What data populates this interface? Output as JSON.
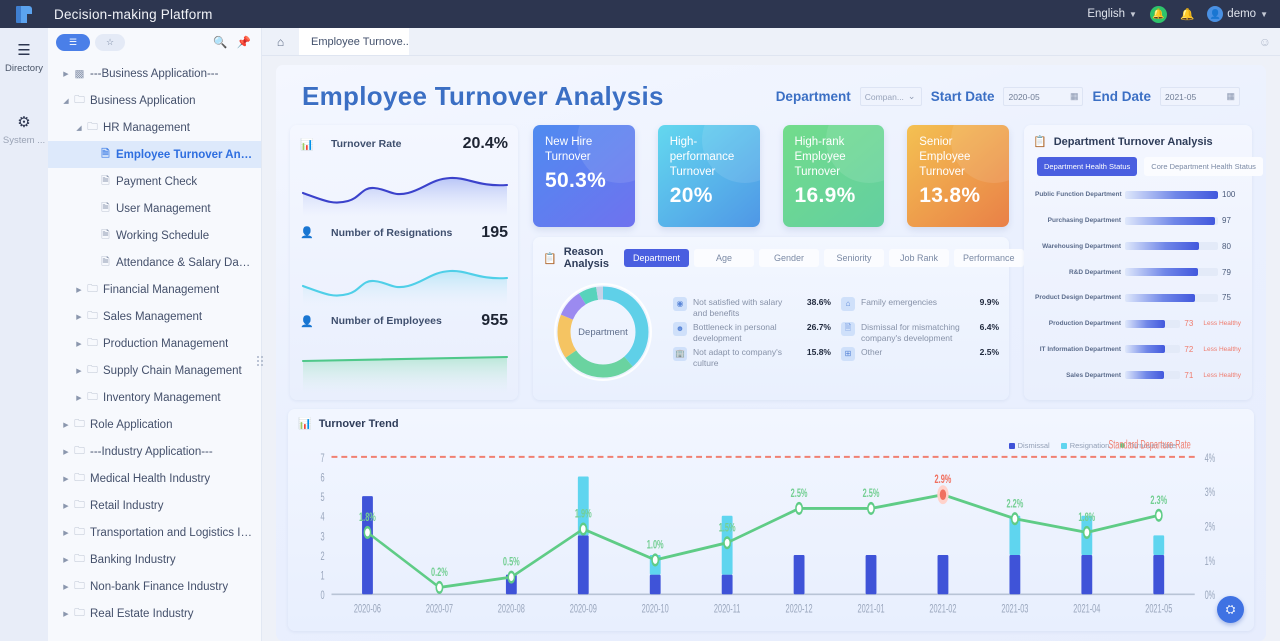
{
  "topbar": {
    "app_title": "Decision-making Platform",
    "language": "English",
    "user": "demo",
    "icons": {
      "logo": "app-logo",
      "notification_green": "green-bell-icon",
      "bell": "bell-icon",
      "avatar": "user-avatar"
    }
  },
  "rail": {
    "items": [
      {
        "label": "Directory",
        "icon": "list-icon"
      },
      {
        "label": "System ...",
        "icon": "gear-icon"
      }
    ]
  },
  "tree_toolbar": {
    "list_button": "list-view",
    "star_button": "favorites",
    "search": "search-icon",
    "pin": "pin-icon"
  },
  "tree": {
    "items": [
      {
        "label": "---Business Application---",
        "depth": 0,
        "arrow": "right",
        "icon": "apps-icon",
        "selected": false
      },
      {
        "label": "Business Application",
        "depth": 0,
        "arrow": "down",
        "icon": "folder-icon",
        "selected": false
      },
      {
        "label": "HR Management",
        "depth": 1,
        "arrow": "down",
        "icon": "folder-icon",
        "selected": false
      },
      {
        "label": "Employee Turnover Anal...",
        "depth": 2,
        "arrow": "none",
        "icon": "file-icon",
        "selected": true
      },
      {
        "label": "Payment Check",
        "depth": 2,
        "arrow": "none",
        "icon": "file-icon",
        "selected": false
      },
      {
        "label": "User Management",
        "depth": 2,
        "arrow": "none",
        "icon": "file-icon",
        "selected": false
      },
      {
        "label": "Working Schedule",
        "depth": 2,
        "arrow": "none",
        "icon": "file-icon",
        "selected": false
      },
      {
        "label": "Attendance & Salary Dash...",
        "depth": 2,
        "arrow": "none",
        "icon": "file-icon",
        "selected": false
      },
      {
        "label": "Financial Management",
        "depth": 1,
        "arrow": "right",
        "icon": "folder-icon",
        "selected": false
      },
      {
        "label": "Sales Management",
        "depth": 1,
        "arrow": "right",
        "icon": "folder-icon",
        "selected": false
      },
      {
        "label": "Production Management",
        "depth": 1,
        "arrow": "right",
        "icon": "folder-icon",
        "selected": false
      },
      {
        "label": "Supply Chain Management",
        "depth": 1,
        "arrow": "right",
        "icon": "folder-icon",
        "selected": false
      },
      {
        "label": "Inventory Management",
        "depth": 1,
        "arrow": "right",
        "icon": "folder-icon",
        "selected": false
      },
      {
        "label": "Role Application",
        "depth": 0,
        "arrow": "right",
        "icon": "folder-icon",
        "selected": false
      },
      {
        "label": "---Industry Application---",
        "depth": 0,
        "arrow": "right",
        "icon": "folder-icon",
        "selected": false
      },
      {
        "label": "Medical Health Industry",
        "depth": 0,
        "arrow": "right",
        "icon": "folder-icon",
        "selected": false
      },
      {
        "label": "Retail Industry",
        "depth": 0,
        "arrow": "right",
        "icon": "folder-icon",
        "selected": false
      },
      {
        "label": "Transportation and Logistics In...",
        "depth": 0,
        "arrow": "right",
        "icon": "folder-icon",
        "selected": false
      },
      {
        "label": "Banking Industry",
        "depth": 0,
        "arrow": "right",
        "icon": "folder-icon",
        "selected": false
      },
      {
        "label": "Non-bank Finance Industry",
        "depth": 0,
        "arrow": "right",
        "icon": "folder-icon",
        "selected": false
      },
      {
        "label": "Real Estate Industry",
        "depth": 0,
        "arrow": "right",
        "icon": "folder-icon",
        "selected": false
      }
    ]
  },
  "tabs": {
    "home_icon": "home-icon",
    "open": "Employee Turnove...",
    "right_icon": "smiley-icon"
  },
  "dashboard": {
    "title": "Employee Turnover Analysis",
    "filters": {
      "department_label": "Department",
      "department_value": "Compan...",
      "start_label": "Start Date",
      "start_value": "2020-05",
      "end_label": "End Date",
      "end_value": "2021-05",
      "calendar_icon": "calendar-icon"
    },
    "metrics": [
      {
        "title": "Turnover Rate",
        "value": "20.4%",
        "icon": "chart-icon",
        "color": "#4040cf"
      },
      {
        "title": "Number of Resignations",
        "value": "195",
        "icon": "user-icon",
        "color": "#4ec8e8"
      },
      {
        "title": "Number of Employees",
        "value": "955",
        "icon": "user-icon",
        "color": "#5ecb8e"
      }
    ],
    "kpis": [
      {
        "label": "New Hire Turnover",
        "value": "50.3%",
        "from": "#4f8bf0",
        "to": "#6f72ef"
      },
      {
        "label": "High-performance Turnover",
        "value": "20%",
        "from": "#63d8ef",
        "to": "#4f97e6"
      },
      {
        "label": "High-rank Employee Turnover",
        "value": "16.9%",
        "from": "#72dc8b",
        "to": "#63cfa1"
      },
      {
        "label": "Senior Employee Turnover",
        "value": "13.8%",
        "from": "#f4c152",
        "to": "#e98047"
      }
    ],
    "reason_analysis": {
      "title": "Reason Analysis",
      "icon": "clipboard-icon",
      "tabs": [
        "Department",
        "Age",
        "Gender",
        "Seniority",
        "Job Rank",
        "Performance"
      ],
      "active_tab": "Department",
      "donut_center": "Department",
      "reasons": [
        {
          "label": "Not satisfied with salary and benefits",
          "value": "38.6%",
          "icon": "coin-icon",
          "color": "#5fd0e8"
        },
        {
          "label": "Bottleneck in personal development",
          "value": "26.7%",
          "icon": "person-badge-icon",
          "color": "#6ad3a0"
        },
        {
          "label": "Not adapt to company's culture",
          "value": "15.8%",
          "icon": "building-icon",
          "color": "#f5c462"
        },
        {
          "label": "Family emergencies",
          "value": "9.9%",
          "icon": "home-icon",
          "color": "#9b8af0"
        },
        {
          "label": "Dismissal for mismatching company's development",
          "value": "6.4%",
          "icon": "document-icon",
          "color": "#58d3bc"
        },
        {
          "label": "Other",
          "value": "2.5%",
          "icon": "grid-icon",
          "color": "#c7d2e8"
        }
      ]
    },
    "department_analysis": {
      "title": "Department Turnover Analysis",
      "icon": "clipboard-icon",
      "tabs": [
        "Department Health Status",
        "Core Department Health Status"
      ],
      "active_tab": "Department Health Status",
      "rows": [
        {
          "name": "Public Function Department",
          "value": 100,
          "tag": ""
        },
        {
          "name": "Purchasing Department",
          "value": 97,
          "tag": ""
        },
        {
          "name": "Warehousing Department",
          "value": 80,
          "tag": ""
        },
        {
          "name": "R&D Department",
          "value": 79,
          "tag": ""
        },
        {
          "name": "Product Design Department",
          "value": 75,
          "tag": ""
        },
        {
          "name": "Production Department",
          "value": 73,
          "tag": "Less Healthy"
        },
        {
          "name": "IT Information Department",
          "value": 72,
          "tag": "Less Healthy"
        },
        {
          "name": "Sales Department",
          "value": 71,
          "tag": "Less Healthy"
        }
      ]
    },
    "trend": {
      "title": "Turnover Trend",
      "icon": "chart-bar-icon",
      "legend": [
        {
          "name": "Dismissal",
          "color": "#3f53d8"
        },
        {
          "name": "Resignation",
          "color": "#5fd5ef"
        },
        {
          "name": "Turnover Rate",
          "color": "#5fcc86"
        }
      ],
      "threshold_label": "Standard Departure Rate"
    }
  },
  "chart_data": {
    "type": "bar",
    "title": "Turnover Trend",
    "categories": [
      "2020-06",
      "2020-07",
      "2020-08",
      "2020-09",
      "2020-10",
      "2020-11",
      "2020-12",
      "2021-01",
      "2021-02",
      "2021-03",
      "2021-04",
      "2021-05"
    ],
    "series": [
      {
        "name": "Dismissal",
        "type": "bar",
        "color": "#3f53d8",
        "values": [
          5,
          0,
          1,
          3,
          1,
          1,
          2,
          2,
          2,
          2,
          2,
          2
        ]
      },
      {
        "name": "Resignation",
        "type": "bar",
        "color": "#5fd5ef",
        "values": [
          0,
          0,
          0,
          3,
          1,
          3,
          0,
          0,
          0,
          2,
          2,
          1
        ]
      },
      {
        "name": "Turnover Rate",
        "type": "line",
        "color": "#5fcc86",
        "values": [
          1.8,
          0.2,
          0.5,
          1.9,
          1.0,
          1.5,
          2.5,
          2.5,
          2.9,
          2.2,
          1.8,
          2.3
        ],
        "labels": [
          "1.8%",
          "0.2%",
          "0.5%",
          "1.9%",
          "1.0%",
          "1.5%",
          "2.5%",
          "2.5%",
          "2.9%",
          "2.2%",
          "1.8%",
          "2.3%"
        ]
      }
    ],
    "ylabel_left": "",
    "ylim_left": [
      0,
      7
    ],
    "yticks_left": [
      "0",
      "1",
      "2",
      "3",
      "4",
      "5",
      "6",
      "7"
    ],
    "ylabel_right": "",
    "ylim_right": [
      0,
      4
    ],
    "yticks_right": [
      "0%",
      "1%",
      "2%",
      "3%",
      "4%"
    ],
    "threshold": {
      "value": 4,
      "label": "Standard Departure Rate",
      "color": "#f08072"
    },
    "highlight_point": {
      "category": "2021-02",
      "value": 2.9,
      "color": "#f0705f"
    },
    "grid": false,
    "legend_position": "top-right"
  },
  "fab": {
    "icon": "alert-icon"
  }
}
